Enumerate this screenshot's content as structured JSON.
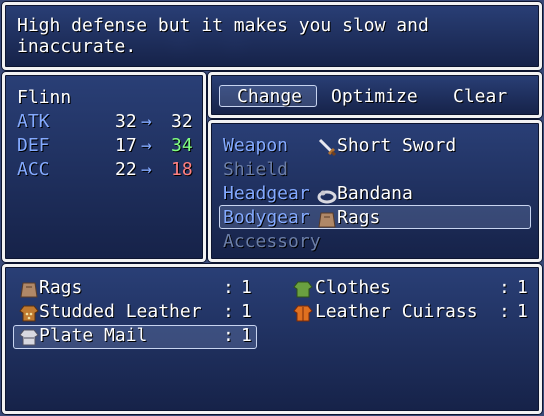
{
  "help": {
    "text": "High defense but it makes you slow and inaccurate."
  },
  "status": {
    "actor": "Flinn",
    "arrow": "→",
    "rows": [
      {
        "label": "ATK",
        "current": "32",
        "next": "32",
        "trend": "same"
      },
      {
        "label": "DEF",
        "current": "17",
        "next": "34",
        "trend": "up"
      },
      {
        "label": "ACC",
        "current": "22",
        "next": "18",
        "trend": "down"
      }
    ]
  },
  "commands": {
    "items": [
      "Change",
      "Optimize",
      "Clear"
    ],
    "selected": "Change"
  },
  "slots": [
    {
      "label": "Weapon",
      "item": "Short Sword",
      "icon": "sword-icon",
      "enabled": true
    },
    {
      "label": "Shield",
      "item": "",
      "icon": "",
      "enabled": false
    },
    {
      "label": "Headgear",
      "item": "Bandana",
      "icon": "bandana-icon",
      "enabled": true
    },
    {
      "label": "Bodygear",
      "item": "Rags",
      "icon": "rags-icon",
      "enabled": true,
      "selected": true
    },
    {
      "label": "Accessory",
      "item": "",
      "icon": "",
      "enabled": false
    }
  ],
  "inventory": {
    "items": [
      {
        "name": "Rags",
        "qty": "1",
        "icon": "rags-icon"
      },
      {
        "name": "Clothes",
        "qty": "1",
        "icon": "clothes-icon"
      },
      {
        "name": "Studded Leather",
        "qty": "1",
        "icon": "studded-leather-icon"
      },
      {
        "name": "Leather Cuirass",
        "qty": "1",
        "icon": "leather-cuirass-icon"
      },
      {
        "name": "Plate Mail",
        "qty": "1",
        "icon": "plate-mail-icon",
        "selected": true
      }
    ],
    "qty_prefix": ":"
  },
  "colors": {
    "system": "#84aaff",
    "up": "#80ff80",
    "down": "#ff8080"
  }
}
